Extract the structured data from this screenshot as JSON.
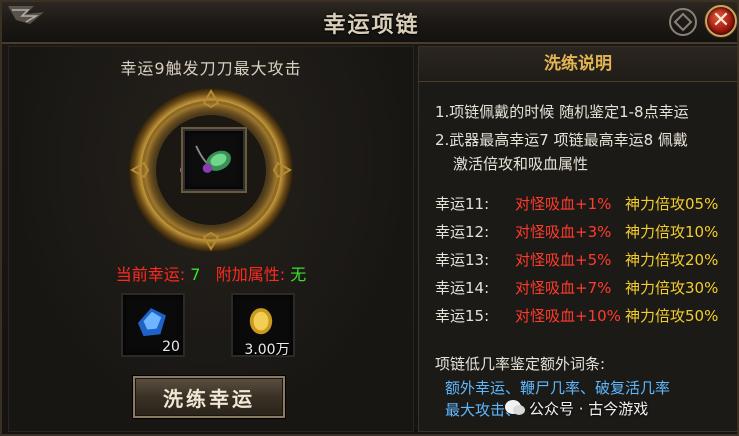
{
  "window": {
    "title": "幸运项链",
    "close_label": "✕"
  },
  "left": {
    "luck_heading": "幸运9触发刀刀最大攻击",
    "current_luck_label": "当前幸运:",
    "current_luck_value": "7",
    "extra_attr_label": "附加属性:",
    "extra_attr_value": "无",
    "slot_gem_count": "20",
    "slot_gold_count": "3.00万",
    "refine_button": "洗练幸运"
  },
  "right": {
    "header": "洗练说明",
    "rule1": "1.项链佩戴的时候 随机鉴定1-8点幸运",
    "rule2a": "2.武器最高幸运7 项链最高幸运8 佩戴",
    "rule2b": "激活倍攻和吸血属性",
    "luck_table": [
      {
        "level": "幸运11:",
        "lifesteal": "对怪吸血+1%",
        "multi": "神力倍攻05%"
      },
      {
        "level": "幸运12:",
        "lifesteal": "对怪吸血+3%",
        "multi": "神力倍攻10%"
      },
      {
        "level": "幸运13:",
        "lifesteal": "对怪吸血+5%",
        "multi": "神力倍攻20%"
      },
      {
        "level": "幸运14:",
        "lifesteal": "对怪吸血+7%",
        "multi": "神力倍攻30%"
      },
      {
        "level": "幸运15:",
        "lifesteal": "对怪吸血+10%",
        "multi": "神力倍攻50%"
      }
    ],
    "extra_title": "项链低几率鉴定额外词条:",
    "extra_line1": "额外幸运、鞭尸几率、破复活几率",
    "extra_line2": "最大攻击、"
  },
  "watermark": "公众号 · 古今游戏",
  "colors": {
    "accent_gold": "#e2b552",
    "red": "#ff2a1e",
    "green": "#39e12a",
    "yellow": "#f2cd2b",
    "blue": "#5fb8ff"
  },
  "icons": [
    "close-icon",
    "amulet-ring-icon",
    "necklace-icon",
    "blue-gem-icon",
    "gold-coin-icon",
    "wechat-icon"
  ]
}
